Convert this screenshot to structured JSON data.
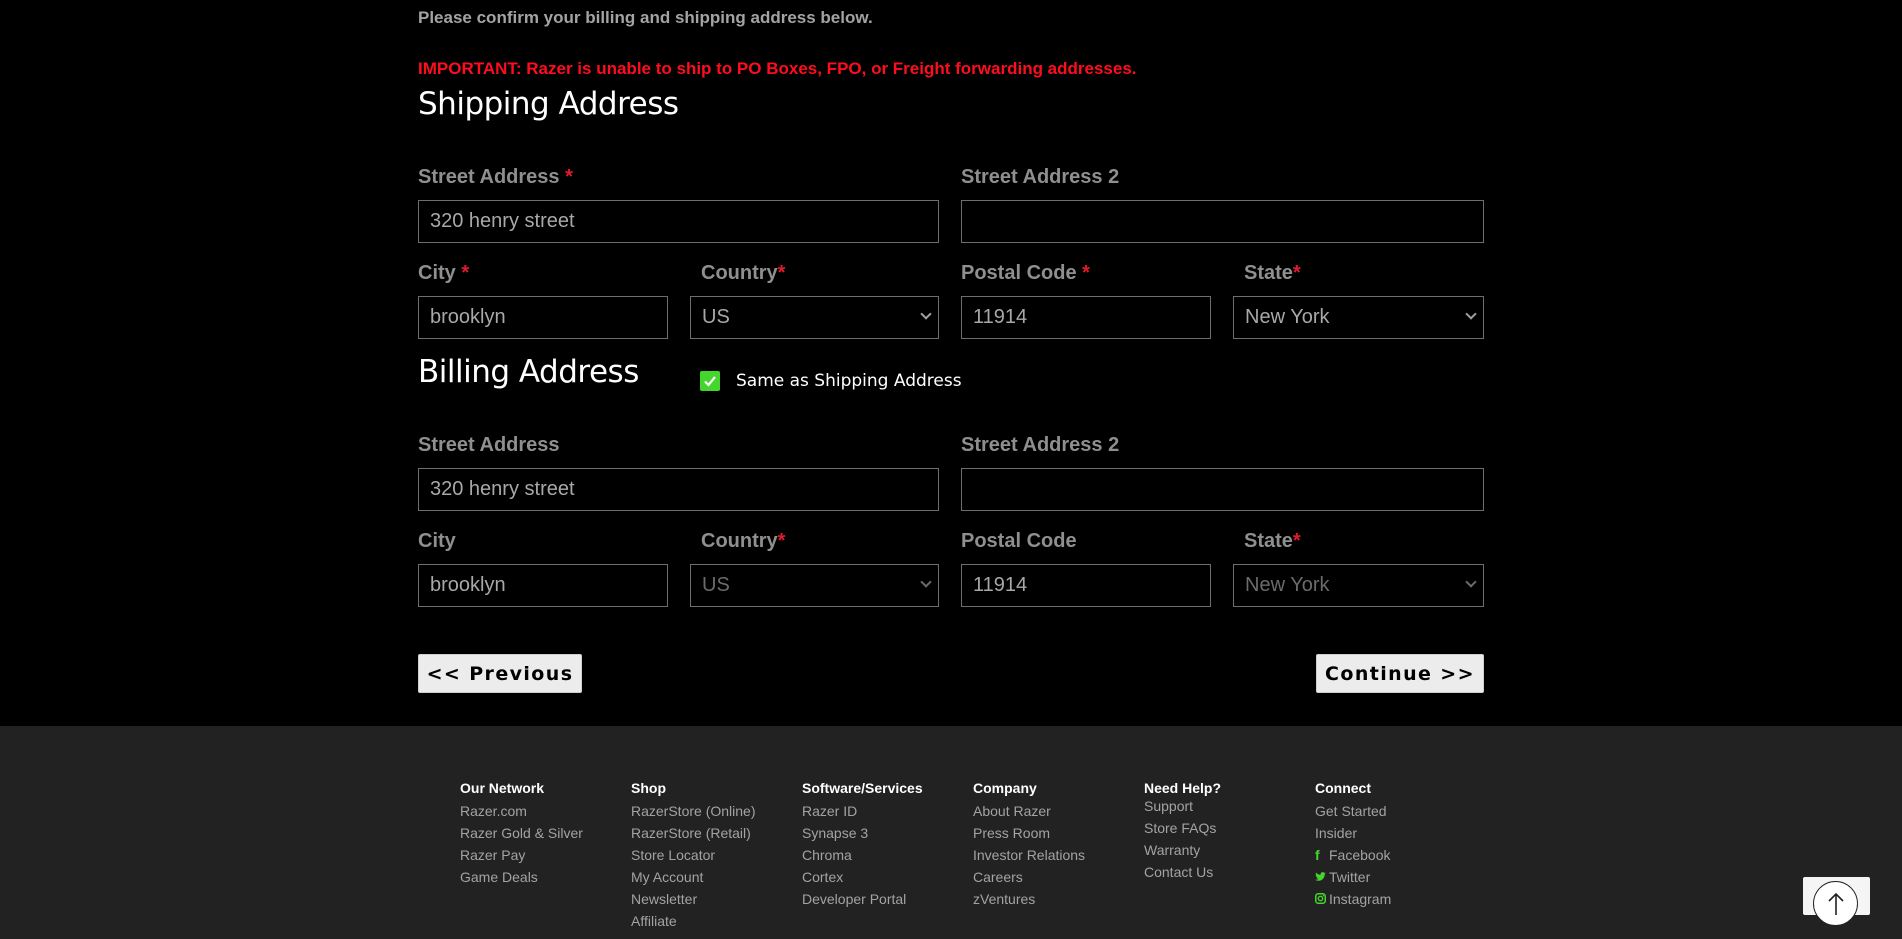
{
  "intro": "Please confirm your billing and shipping address below.",
  "important": "IMPORTANT: Razer is unable to ship to PO Boxes, FPO, or Freight forwarding addresses.",
  "shipping": {
    "title": "Shipping Address",
    "street_label": "Street Address",
    "street_value": "320 henry street",
    "street2_label": "Street Address 2",
    "street2_value": "",
    "city_label": "City",
    "city_value": "brooklyn",
    "country_label": "Country",
    "country_value": "US",
    "postal_label": "Postal Code",
    "postal_value": "11914",
    "state_label": "State",
    "state_value": "New York",
    "required_mark": "*"
  },
  "billing": {
    "title": "Billing Address",
    "same_as_label": "Same as Shipping Address",
    "same_as_checked": true,
    "street_label": "Street Address",
    "street_value": "320 henry street",
    "street2_label": "Street Address 2",
    "street2_value": "",
    "city_label": "City",
    "city_value": "brooklyn",
    "country_label": "Country",
    "country_value": "US",
    "postal_label": "Postal Code",
    "postal_value": "11914",
    "state_label": "State",
    "state_value": "New York",
    "required_mark": "*"
  },
  "buttons": {
    "previous": "<< Previous",
    "continue": "Continue >>"
  },
  "footer": {
    "columns": [
      {
        "heading": "Our Network",
        "links": [
          "Razer.com",
          "Razer Gold & Silver",
          "Razer Pay",
          "Game Deals"
        ]
      },
      {
        "heading": "Shop",
        "links": [
          "RazerStore (Online)",
          "RazerStore (Retail)",
          "Store Locator",
          "My Account",
          "Newsletter",
          "Affiliate"
        ]
      },
      {
        "heading": "Software/Services",
        "links": [
          "Razer ID",
          "Synapse 3",
          "Chroma",
          "Cortex",
          "Developer Portal"
        ]
      },
      {
        "heading": "Company",
        "links": [
          "About Razer",
          "Press Room",
          "Investor Relations",
          "Careers",
          "zVentures"
        ]
      },
      {
        "heading": "Need Help?",
        "links": [
          "Support",
          "Store FAQs",
          "Warranty",
          "Contact Us"
        ]
      },
      {
        "heading": "Connect",
        "links": [
          "Get Started",
          "Insider"
        ],
        "social": [
          {
            "icon": "facebook-icon",
            "label": "Facebook"
          },
          {
            "icon": "twitter-icon",
            "label": "Twitter"
          },
          {
            "icon": "instagram-icon",
            "label": "Instagram"
          }
        ]
      }
    ]
  },
  "colors": {
    "accent": "#44d62c",
    "important_red": "#ff0d1f",
    "required_red": "#e21b2b",
    "footer_bg": "#222222"
  },
  "icons": {
    "back_to_top": "arrow-up-icon",
    "checkbox": "checkmark-icon"
  }
}
